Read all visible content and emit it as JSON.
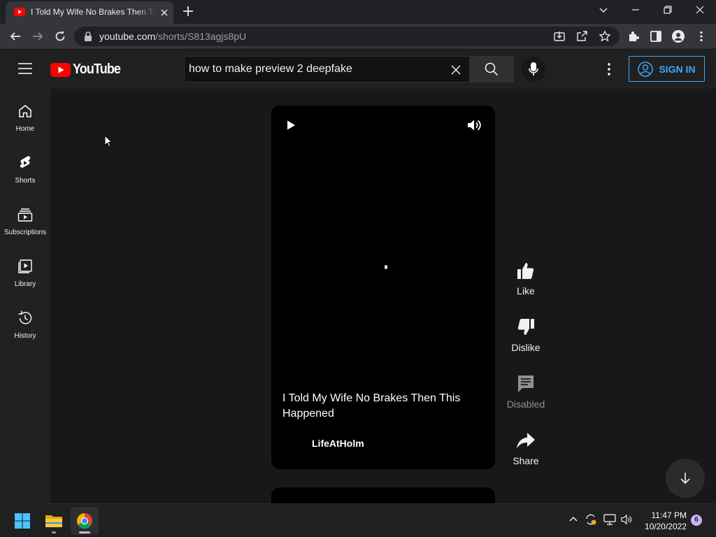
{
  "browser": {
    "tab_title": "I Told My Wife No Brakes Then This Happened - YouTube",
    "url_host": "youtube.com",
    "url_path": "/shorts/S813agjs8pU"
  },
  "youtube": {
    "logo_text": "YouTube",
    "search_value": "how to make preview 2 deepfake",
    "signin_label": "SIGN IN",
    "brand_color": "#ff0000",
    "accent_color": "#3ea6ff"
  },
  "guide": {
    "items": [
      {
        "label": "Home",
        "icon": "home-icon"
      },
      {
        "label": "Shorts",
        "icon": "shorts-icon"
      },
      {
        "label": "Subscriptions",
        "icon": "subscriptions-icon"
      },
      {
        "label": "Library",
        "icon": "library-icon"
      },
      {
        "label": "History",
        "icon": "history-icon"
      }
    ]
  },
  "short": {
    "title": "I Told My Wife No Brakes Then This Happened",
    "channel": "LifeAtHolm"
  },
  "actions": {
    "like": "Like",
    "dislike": "Dislike",
    "comments": "Disabled",
    "share": "Share"
  },
  "taskbar": {
    "time": "11:47 PM",
    "date": "10/20/2022",
    "notifications": "6"
  }
}
